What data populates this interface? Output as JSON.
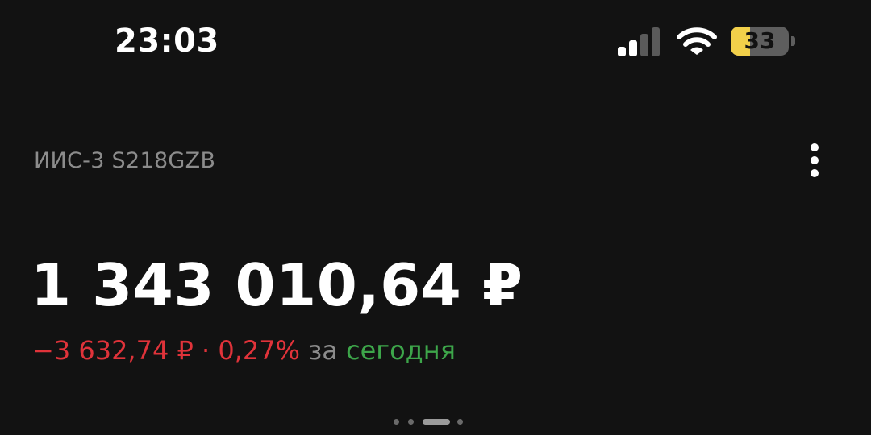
{
  "status_bar": {
    "time": "23:03",
    "battery_level": "33",
    "battery_fraction": 0.33,
    "signal_bars_active": 2,
    "signal_bars_total": 4,
    "battery_fill_color": "#f2d04a",
    "signal_active_color": "#ffffff",
    "signal_inactive_color": "#5a5a5a"
  },
  "header": {
    "account_name": "ИИС-3 S218GZB",
    "more_icon": "more-vertical-icon"
  },
  "balance": {
    "amount": "1 343 010,64 ₽"
  },
  "change": {
    "amount_text": "−3 632,74 ₽ · 0,27%",
    "period_label": " за ",
    "period_value": "сегодня",
    "negative_color": "#e0333a",
    "positive_color": "#3da64a"
  },
  "pager": {
    "total_pages": 4,
    "active_page": 3
  }
}
